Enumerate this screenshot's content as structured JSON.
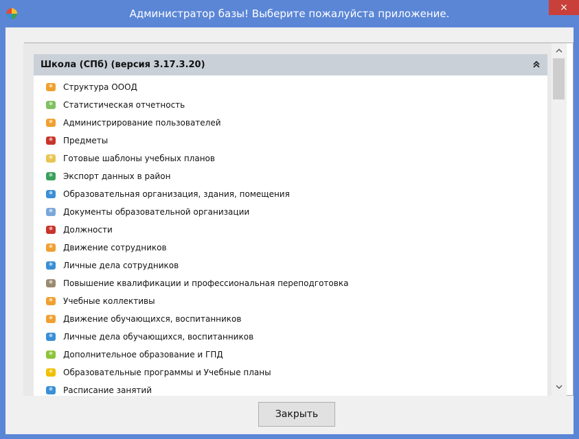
{
  "window": {
    "title": "Администратор базы! Выберите пожалуйста приложение.",
    "close_glyph": "×"
  },
  "group": {
    "title": "Школа (СПб) (версия 3.17.3.20)",
    "collapse_glyph": "«"
  },
  "items": [
    {
      "label": "Структура ОООД",
      "icon": "person-orange-icon",
      "color": "#f0a030"
    },
    {
      "label": "Статистическая отчетность",
      "icon": "report-icon",
      "color": "#7fc060"
    },
    {
      "label": "Администрирование пользователей",
      "icon": "user-admin-icon",
      "color": "#f0a030"
    },
    {
      "label": "Предметы",
      "icon": "blackboard-icon",
      "color": "#c8342c"
    },
    {
      "label": "Готовые шаблоны учебных планов",
      "icon": "folder-doc-icon",
      "color": "#e9c550"
    },
    {
      "label": "Экспорт данных в район",
      "icon": "globe-export-icon",
      "color": "#3aa05a"
    },
    {
      "label": "Образовательная организация, здания, помещения",
      "icon": "building-icon",
      "color": "#3a8fd6"
    },
    {
      "label": "Документы образовательной организации",
      "icon": "documents-icon",
      "color": "#7aa7d9"
    },
    {
      "label": "Должности",
      "icon": "briefcase-icon",
      "color": "#c8342c"
    },
    {
      "label": "Движение сотрудников",
      "icon": "person-move-icon",
      "color": "#f0a030"
    },
    {
      "label": "Личные дела сотрудников",
      "icon": "card-icon",
      "color": "#3a8fd6"
    },
    {
      "label": "Повышение квалификации и профессиональная переподготовка",
      "icon": "graduate-icon",
      "color": "#9a8a70"
    },
    {
      "label": "Учебные коллективы",
      "icon": "group-icon",
      "color": "#f0a030"
    },
    {
      "label": "Движение обучающихся, воспитанников",
      "icon": "student-move-icon",
      "color": "#f0a030"
    },
    {
      "label": "Личные дела обучающихся, воспитанников",
      "icon": "student-card-icon",
      "color": "#3a8fd6"
    },
    {
      "label": "Дополнительное образование и ГПД",
      "icon": "extra-education-icon",
      "color": "#8cc43a"
    },
    {
      "label": "Образовательные программы и Учебные планы",
      "icon": "program-icon",
      "color": "#f0c000"
    },
    {
      "label": "Расписание занятий",
      "icon": "schedule-icon",
      "color": "#3a8fd6"
    }
  ],
  "scrollbar": {
    "up_glyph": "^",
    "down_glyph": "v"
  },
  "footer": {
    "close_label": "Закрыть"
  }
}
